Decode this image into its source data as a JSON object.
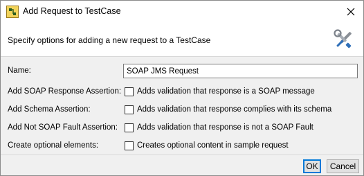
{
  "window": {
    "title": "Add Request to TestCase",
    "app_icon": "soapui-icon",
    "close_icon": "close-icon"
  },
  "header": {
    "description": "Specify options for adding a new request to a TestCase",
    "icon": "tools-icon"
  },
  "form": {
    "name_label": "Name:",
    "name_value": "SOAP JMS Request",
    "options": [
      {
        "label": "Add SOAP Response Assertion:",
        "text": "Adds validation that response is a SOAP message",
        "checked": false
      },
      {
        "label": "Add Schema Assertion:",
        "text": "Adds validation that response complies with its schema",
        "checked": false
      },
      {
        "label": "Add Not SOAP Fault Assertion:",
        "text": "Adds validation that response is not a SOAP Fault",
        "checked": false
      },
      {
        "label": "Create optional elements:",
        "text": "Creates optional content in sample request",
        "checked": false
      }
    ]
  },
  "buttons": {
    "ok": "OK",
    "cancel": "Cancel"
  },
  "colors": {
    "accent": "#0078d7",
    "background": "#f0f0f0",
    "header_bg": "#ffffff"
  }
}
